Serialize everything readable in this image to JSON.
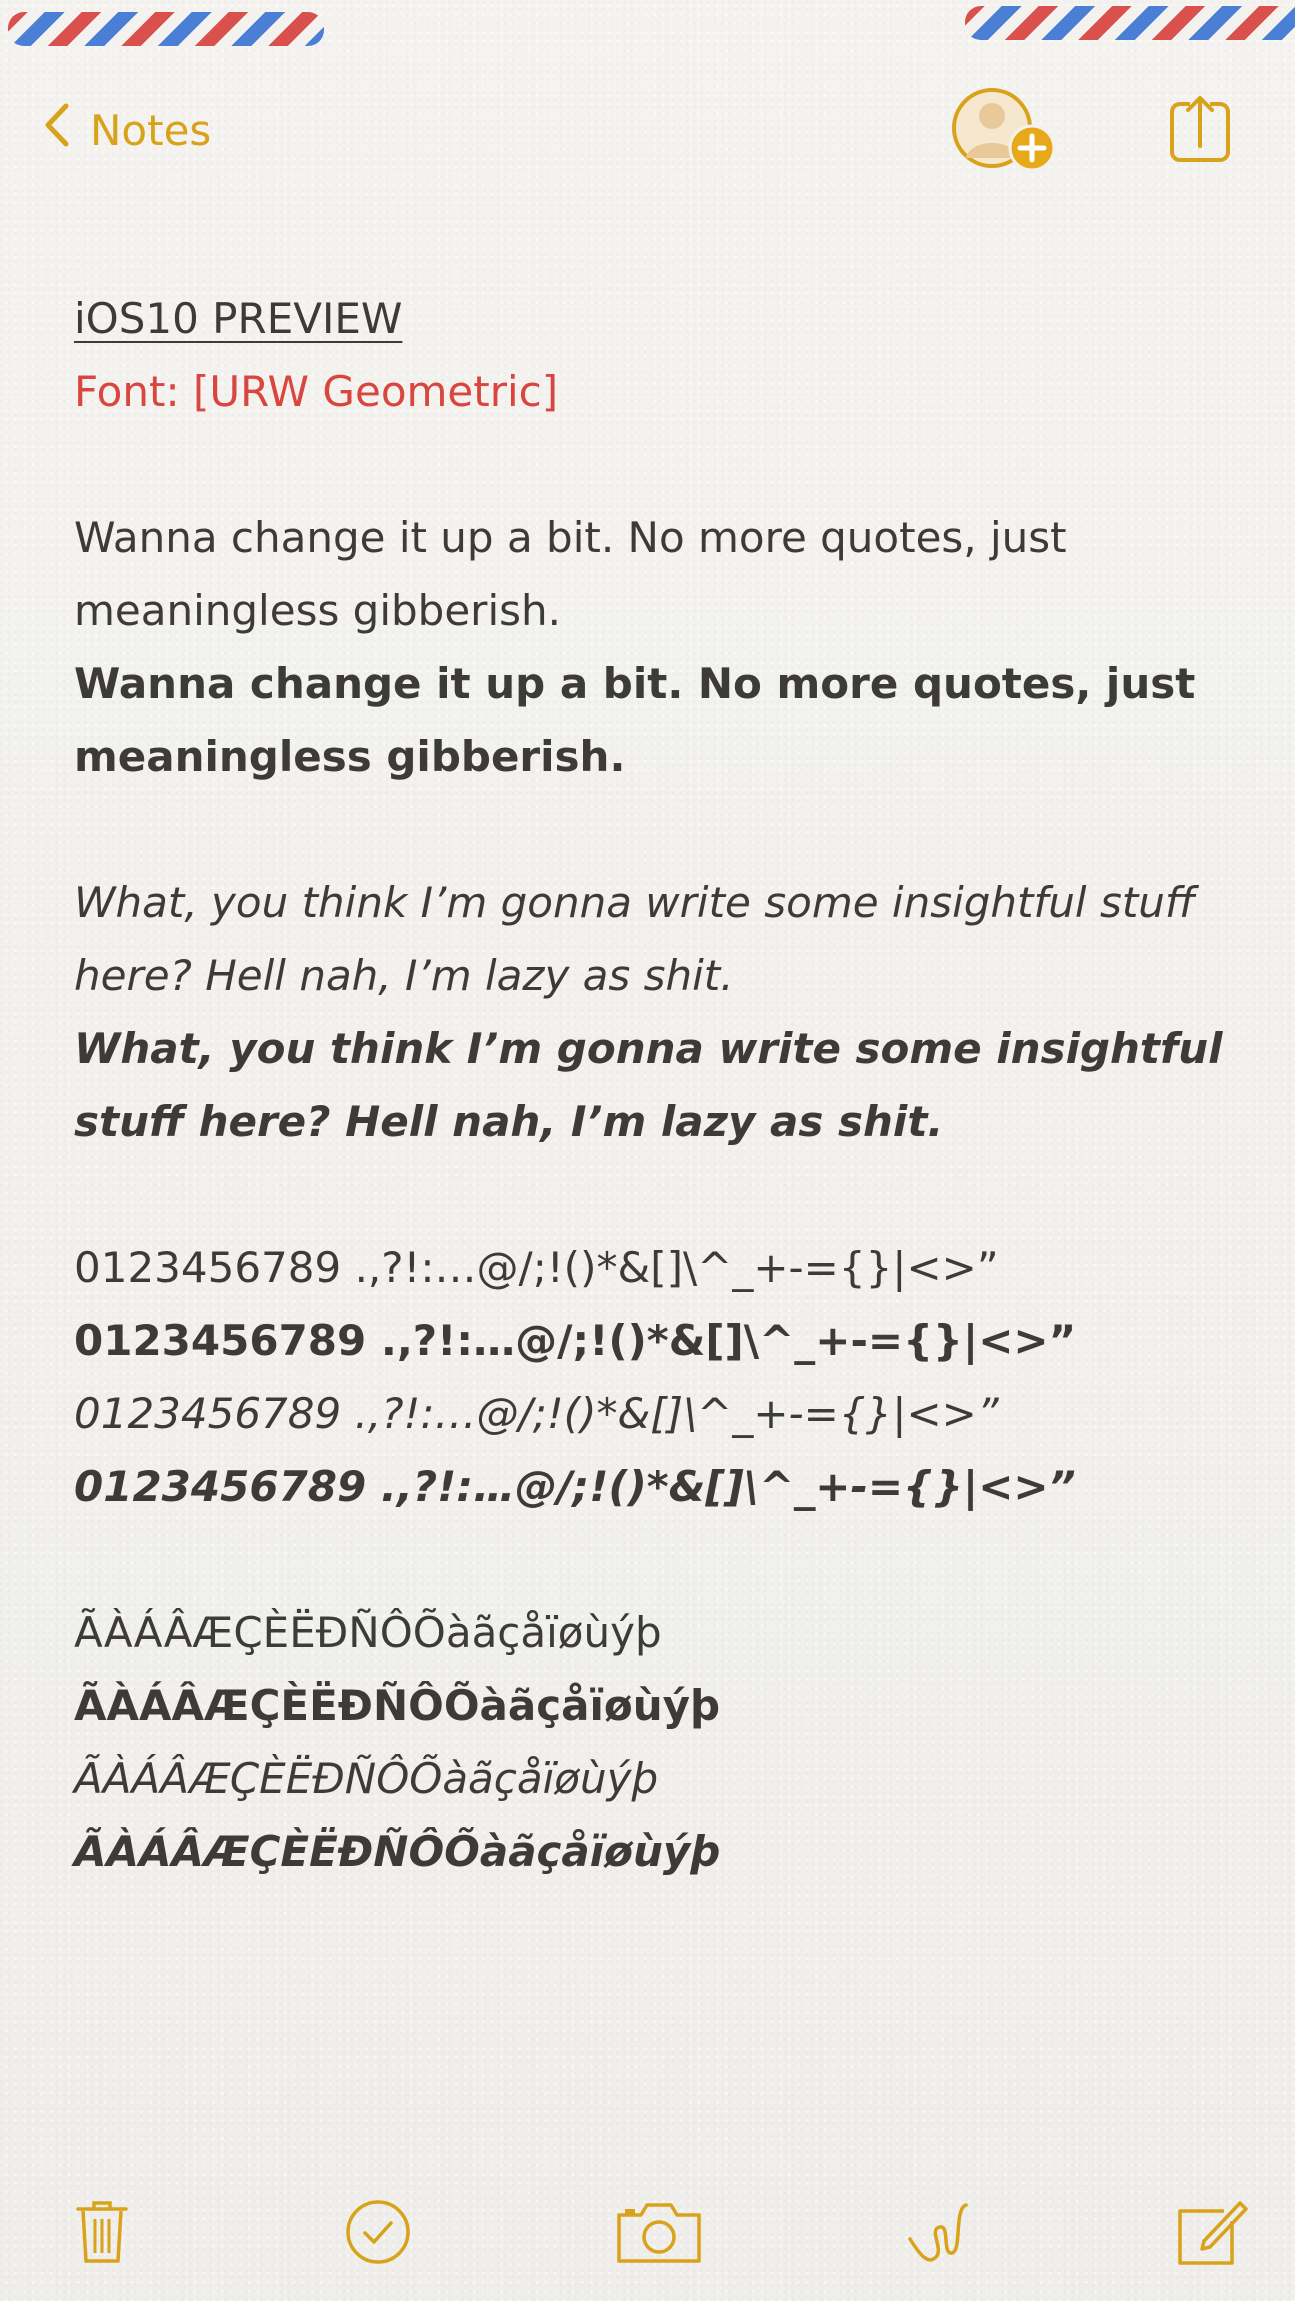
{
  "nav": {
    "back_label": "Notes",
    "accent_color": "#d9a21b"
  },
  "note": {
    "title": "iOS10 PREVIEW",
    "font_label": "Font: [URW Geometric]",
    "para_regular": "Wanna change it up a bit. No more quotes, just meaningless gibberish.",
    "para_bold": "Wanna change it up a bit. No more quotes, just meaningless gibberish.",
    "para_italic": "What, you think I’m gonna write some insightful stuff here? Hell nah, I’m lazy as shit.",
    "para_bold_italic": "What, you think I’m gonna write some insightful stuff here? Hell nah, I’m lazy as shit.",
    "digits_regular": "0123456789 .,?!:…@/;!()*&[]\\^_+-={}|<>”",
    "digits_bold": "0123456789 .,?!:…@/;!()*&[]\\^_+-={}|<>”",
    "digits_italic": "0123456789 .,?!:…@/;!()*&[]\\^_+-={}|<>”",
    "digits_bold_italic": "0123456789 .,?!:…@/;!()*&[]\\^_+-={}|<>”",
    "accents_regular": "ÃÀÁÂÆÇÈËÐÑÔÕàãçåïøùýþ",
    "accents_bold": "ÃÀÁÂÆÇÈËÐÑÔÕàãçåïøùýþ",
    "accents_italic": "ÃÀÁÂÆÇÈËÐÑÔÕàãçåïøùýþ",
    "accents_bold_italic": "ÃÀÁÂÆÇÈËÐÑÔÕàãçåïøùýþ"
  },
  "colors": {
    "text": "#3c3b3a",
    "red_label": "#d9463f",
    "airmail_red": "#d9504c",
    "airmail_blue": "#4b7fd6"
  },
  "toolbar": {
    "icons": [
      "trash-icon",
      "checklist-icon",
      "camera-icon",
      "sketch-icon",
      "compose-icon"
    ]
  }
}
